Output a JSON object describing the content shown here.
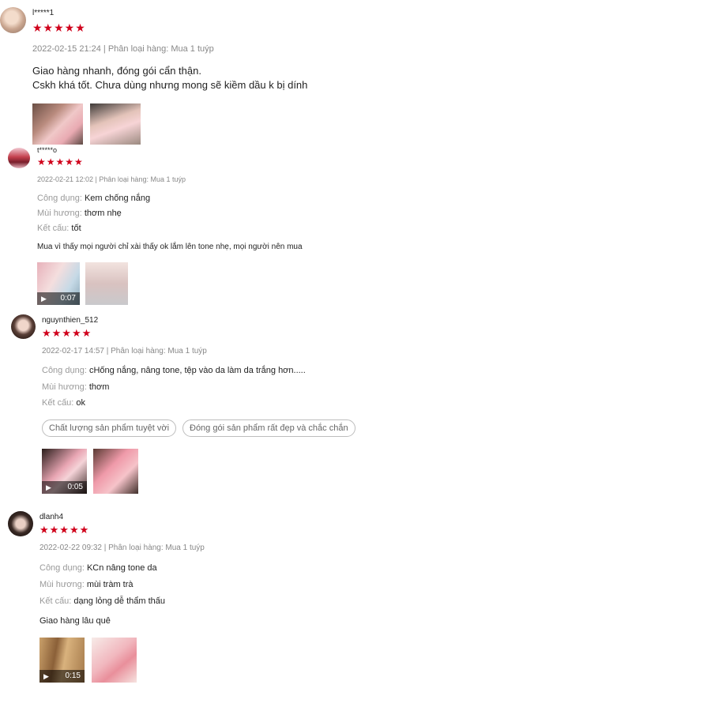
{
  "colors": {
    "star": "#d0011b",
    "meta": "#888888",
    "tag_border": "#bdbdbd"
  },
  "reviews": [
    {
      "username": "l*****1",
      "stars": "★★★★★",
      "meta": "2022-02-15 21:24 | Phân loại hàng: Mua 1 tuýp",
      "lines": [
        "Giao hàng nhanh, đóng gói cẩn thận.",
        "Cskh khá tốt. Chưa dùng nhưng mong sẽ kiềm dầu k bị dính"
      ]
    },
    {
      "username": "t*****o",
      "stars": "★★★★★",
      "meta": "2022-02-21 12:02 | Phân loại hàng: Mua 1 tuýp",
      "attrs": [
        {
          "k": "Công dụng:",
          "v": "Kem chống nắng"
        },
        {
          "k": "Mùi hương:",
          "v": "thơm nhẹ"
        },
        {
          "k": "Kết cấu:",
          "v": "tốt"
        }
      ],
      "comment": "Mua vì thấy mọi người chỉ xài thấy ok lắm lên tone nhẹ, mọi người nên mua",
      "video_icon": "▶",
      "video_duration": "0:07"
    },
    {
      "username": "nguynthien_512",
      "stars": "★★★★★",
      "meta": "2022-02-17 14:57 | Phân loại hàng: Mua 1 tuýp",
      "attrs": [
        {
          "k": "Công dụng:",
          "v": "cHống nắng, nâng tone, tệp vào da làm da trắng hơn....."
        },
        {
          "k": "Mùi hương:",
          "v": "thơm"
        },
        {
          "k": "Kết cấu:",
          "v": "ok"
        }
      ],
      "tags": [
        "Chất lượng sản phẩm tuyệt vời",
        "Đóng gói sản phẩm rất đẹp và chắc chắn"
      ],
      "video_icon": "▶",
      "video_duration": "0:05"
    },
    {
      "username": "dlanh4",
      "stars": "★★★★★",
      "meta": "2022-02-22 09:32 | Phân loại hàng: Mua 1 tuýp",
      "attrs": [
        {
          "k": "Công dụng:",
          "v": "KCn nâng tone da"
        },
        {
          "k": "Mùi hương:",
          "v": "mùi tràm trà"
        },
        {
          "k": "Kết cấu:",
          "v": "dạng lỏng dễ thẩm thấu"
        }
      ],
      "comment": "Giao hàng lâu quê",
      "video_icon": "▶",
      "video_duration": "0:15"
    }
  ]
}
